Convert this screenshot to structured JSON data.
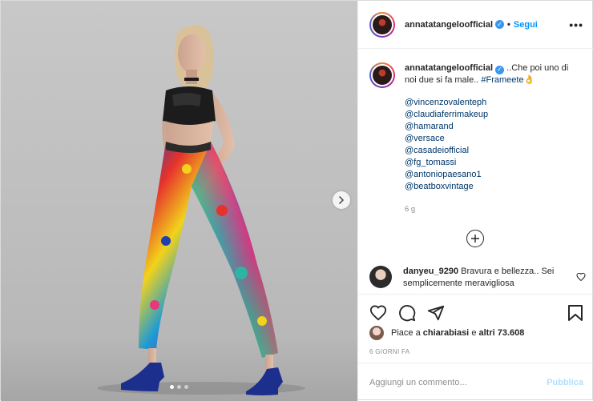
{
  "header": {
    "username": "annatatangeloofficial",
    "separator": "•",
    "follow_label": "Segui",
    "more_label": "•••"
  },
  "caption": {
    "username": "annatatangeloofficial",
    "text": "..Che poi uno di noi due si fa male..",
    "hashtag": "#Frameete",
    "emoji": "👌",
    "mentions": [
      "@vincenzovalenteph",
      "@claudiaferrimakeup",
      "@hamarand",
      "@versace",
      "@casadeiofficial",
      "@fg_tomassi",
      "@antoniopaesano1",
      "@beatboxvintage"
    ],
    "age": "6 g"
  },
  "comment": {
    "username": "danyeu_9290",
    "text": "Bravura e bellezza.. Sei semplicemente meravigliosa"
  },
  "likes": {
    "prefix": "Piace a",
    "user": "chiarabiasi",
    "middle": "e",
    "others": "altri 73.608"
  },
  "date": "6 GIORNI FA",
  "comment_box": {
    "placeholder": "Aggiungi un commento...",
    "publish_label": "Pubblica"
  },
  "carousel": {
    "slide_count": 3,
    "active_index": 0
  },
  "colors": {
    "link": "#00376b",
    "follow": "#0095f6",
    "verified": "#3897f0",
    "muted": "#8e8e8e",
    "publish_disabled": "#b2dffc"
  },
  "icons": {
    "verified": "verified-badge-icon",
    "more": "more-options-icon",
    "next": "chevron-right-icon",
    "load_more": "plus-circle-icon",
    "like": "heart-icon",
    "comment": "comment-bubble-icon",
    "share": "paper-plane-icon",
    "save": "bookmark-icon"
  }
}
